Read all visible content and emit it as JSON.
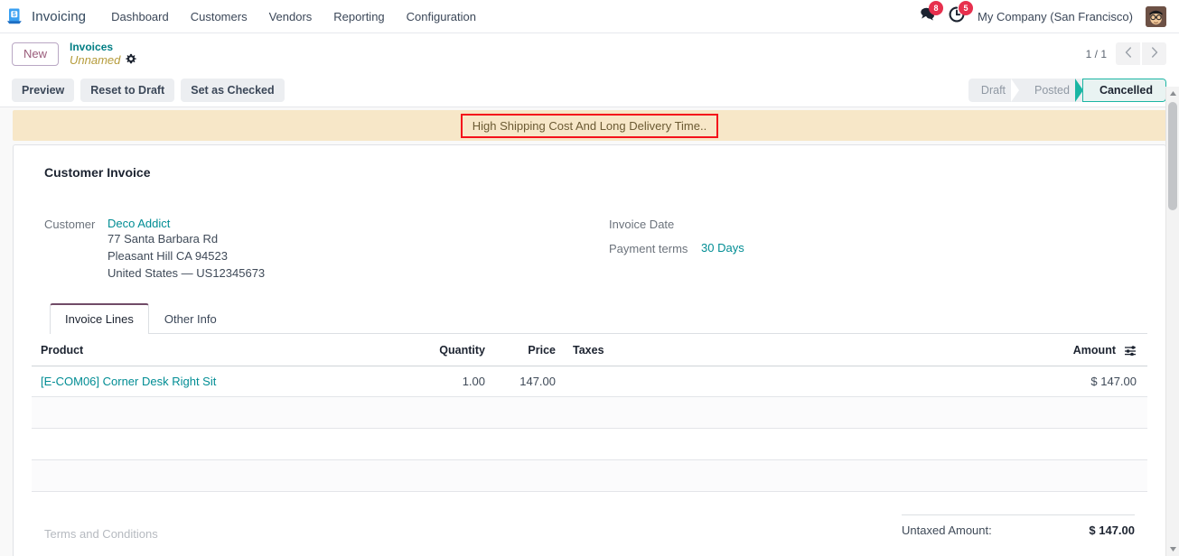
{
  "navbar": {
    "app_name": "Invoicing",
    "logo_icon": "invoicing-app-logo",
    "menu": [
      {
        "label": "Dashboard"
      },
      {
        "label": "Customers"
      },
      {
        "label": "Vendors"
      },
      {
        "label": "Reporting"
      },
      {
        "label": "Configuration"
      }
    ],
    "messages_icon": "chat-bubble-icon",
    "messages_count": "8",
    "activities_icon": "clock-activity-icon",
    "activities_count": "5",
    "company": "My Company (San Francisco)",
    "avatar_icon": "user-avatar"
  },
  "breadcrumb": {
    "new_label": "New",
    "parent": "Invoices",
    "current": "Unnamed",
    "settings_icon": "gear-icon"
  },
  "pager": {
    "count": "1 / 1",
    "prev_icon": "chevron-left-icon",
    "next_icon": "chevron-right-icon"
  },
  "actions": {
    "buttons": [
      {
        "label": "Preview"
      },
      {
        "label": "Reset to Draft"
      },
      {
        "label": "Set as Checked"
      }
    ]
  },
  "statusbar": {
    "stages": [
      {
        "label": "Draft",
        "active": false
      },
      {
        "label": "Posted",
        "active": false
      },
      {
        "label": "Cancelled",
        "active": true
      }
    ]
  },
  "banner": {
    "text": "High Shipping Cost And Long Delivery Time..",
    "border_color": "#f4121b",
    "background_color": "#f7e7c8"
  },
  "form": {
    "title": "Customer Invoice",
    "customer_label": "Customer",
    "customer_name": "Deco Addict",
    "address": [
      "77 Santa Barbara Rd",
      "Pleasant Hill CA 94523",
      "United States — US12345673"
    ],
    "invoice_date_label": "Invoice Date",
    "invoice_date_value": "",
    "payment_terms_label": "Payment terms",
    "payment_terms_value": "30 Days"
  },
  "tabs": [
    {
      "label": "Invoice Lines",
      "active": true
    },
    {
      "label": "Other Info",
      "active": false
    }
  ],
  "lines_table": {
    "headers": {
      "product": "Product",
      "quantity": "Quantity",
      "price": "Price",
      "taxes": "Taxes",
      "amount": "Amount"
    },
    "options_icon": "column-options-icon",
    "rows": [
      {
        "product": "[E-COM06] Corner Desk Right Sit",
        "quantity": "1.00",
        "price": "147.00",
        "taxes": "",
        "amount": "$ 147.00"
      }
    ]
  },
  "footer": {
    "terms_placeholder": "Terms and Conditions",
    "untaxed_label": "Untaxed Amount:",
    "untaxed_value": "$ 147.00"
  },
  "scrollbar": {
    "up_icon": "scroll-up-arrow",
    "down_icon": "scroll-down-arrow"
  }
}
